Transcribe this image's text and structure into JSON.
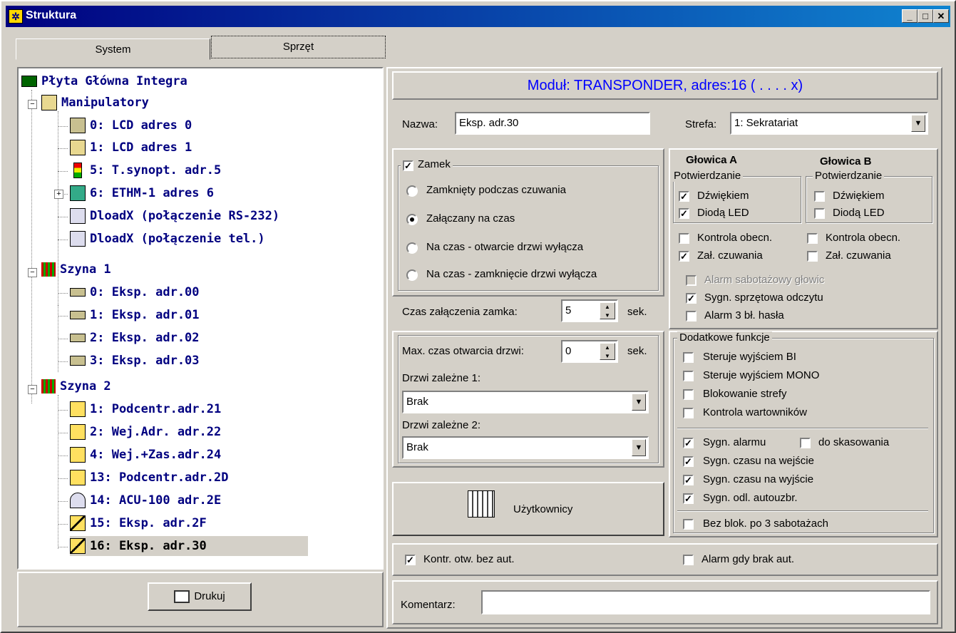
{
  "window": {
    "title": "Struktura",
    "minimize": "_",
    "maximize": "□",
    "close": "✕"
  },
  "tabs": [
    {
      "label": "System"
    },
    {
      "label": "Sprzęt"
    }
  ],
  "tree": {
    "items": [
      {
        "label": "Płyta Główna Integra"
      },
      {
        "label": "Manipulatory"
      },
      {
        "label": "0: LCD adres 0"
      },
      {
        "label": "1: LCD adres 1"
      },
      {
        "label": "5: T.synopt. adr.5"
      },
      {
        "label": "6: ETHM-1 adres 6"
      },
      {
        "label": "DloadX (połączenie RS-232)"
      },
      {
        "label": "DloadX (połączenie tel.)"
      },
      {
        "label": "Szyna 1"
      },
      {
        "label": "0: Eksp. adr.00"
      },
      {
        "label": "1: Eksp. adr.01"
      },
      {
        "label": "2: Eksp. adr.02"
      },
      {
        "label": "3: Eksp. adr.03"
      },
      {
        "label": "Szyna 2"
      },
      {
        "label": "1: Podcentr.adr.21"
      },
      {
        "label": "2: Wej.Adr. adr.22"
      },
      {
        "label": "4: Wej.+Zas.adr.24"
      },
      {
        "label": "13: Podcentr.adr.2D"
      },
      {
        "label": "14: ACU-100  adr.2E"
      },
      {
        "label": "15: Eksp. adr.2F"
      },
      {
        "label": "16: Eksp. adr.30"
      }
    ]
  },
  "print_button": "Drukuj",
  "module_header": "Moduł: TRANSPONDER, adres:16 ( . . . . x)",
  "name": {
    "label": "Nazwa:",
    "value": "Eksp. adr.30"
  },
  "zone": {
    "label": "Strefa:",
    "value": "1: Sekratariat"
  },
  "lock": {
    "label": "Zamek",
    "checked": true,
    "options": [
      {
        "label": "Zamknięty podczas czuwania",
        "selected": false
      },
      {
        "label": "Załączany na czas",
        "selected": true
      },
      {
        "label": "Na czas - otwarcie drzwi wyłącza",
        "selected": false
      },
      {
        "label": "Na czas - zamknięcie drzwi wyłącza",
        "selected": false
      }
    ]
  },
  "lock_time": {
    "label": "Czas załączenia zamka:",
    "value": "5",
    "unit": "sek."
  },
  "door": {
    "max_open_label": "Max. czas otwarcia drzwi:",
    "max_open_value": "0",
    "unit": "sek.",
    "dep1_label": "Drzwi zależne 1:",
    "dep1_value": "Brak",
    "dep2_label": "Drzwi zależne 2:",
    "dep2_value": "Brak"
  },
  "users_button": "Użytkownicy",
  "head_a": {
    "title": "Głowica A",
    "confirm": "Potwierdzanie",
    "sound": "Dźwiękiem",
    "led": "Diodą LED",
    "presence": "Kontrola obecn.",
    "arm": "Zał. czuwania"
  },
  "head_b": {
    "title": "Głowica B",
    "confirm": "Potwierdzanie",
    "sound": "Dźwiękiem",
    "led": "Diodą LED",
    "presence": "Kontrola obecn.",
    "arm": "Zał. czuwania"
  },
  "heads_common": {
    "tamper": "Alarm sabotażowy głowic",
    "hw_signal": "Sygn. sprzętowa odczytu",
    "alarm3": "Alarm 3 bł. hasła"
  },
  "extra": {
    "title": "Dodatkowe funkcje",
    "bi": "Steruje wyjściem BI",
    "mono": "Steruje wyjściem MONO",
    "block": "Blokowanie strefy",
    "guards": "Kontrola wartowników",
    "alarm_sig": "Sygn. alarmu",
    "to_clear": "do skasowania",
    "entry_sig": "Sygn. czasu na wejście",
    "exit_sig": "Sygn. czasu na wyjście",
    "autoarm_sig": "Sygn. odl. autouzbr.",
    "no_block": "Bez blok. po 3 sabotażach"
  },
  "bottom": {
    "ctrl_open": "Kontr. otw. bez aut.",
    "alarm_no_auth": "Alarm gdy brak aut.",
    "comment_label": "Komentarz:",
    "comment_value": ""
  }
}
